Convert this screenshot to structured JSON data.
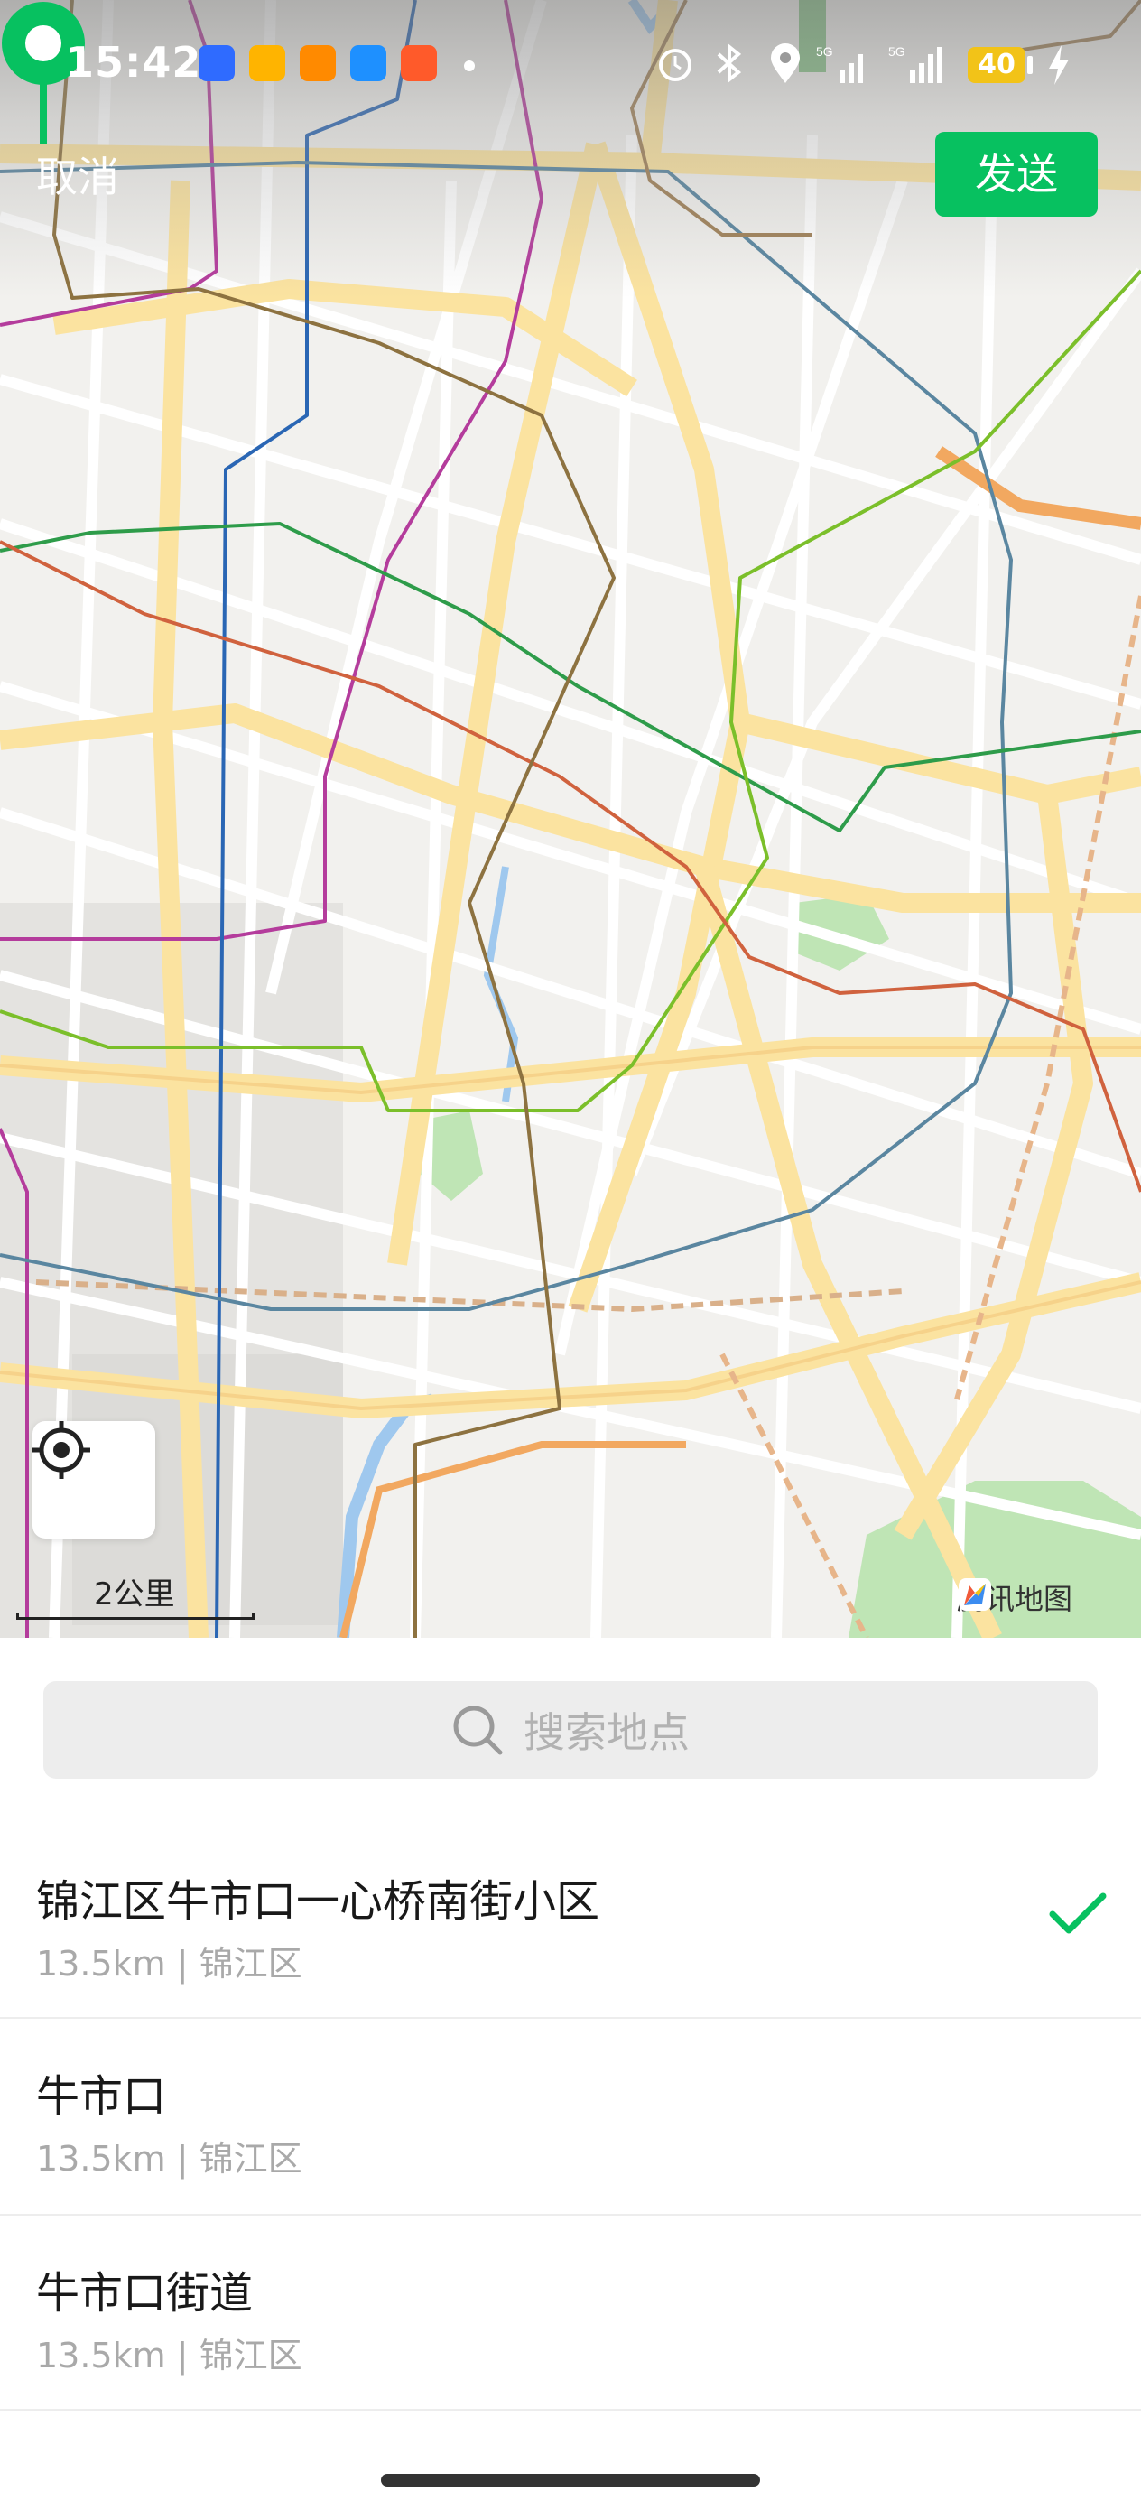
{
  "status_bar": {
    "time": "15:42",
    "battery": "40",
    "icons": [
      "baidu-app-icon",
      "yellow-app-icon",
      "orange-app-icon",
      "blue-app-icon",
      "red-app-icon",
      "alarm-icon",
      "bluetooth-icon",
      "location-icon",
      "signal-5g-icon",
      "signal-5g-icon",
      "charging-icon"
    ],
    "app_colors": [
      "#2f6bff",
      "#ffb400",
      "#ff8a00",
      "#1e90ff",
      "#ff5a2a"
    ]
  },
  "header": {
    "cancel_label": "取消",
    "send_label": "发送",
    "send_color": "#07c160"
  },
  "map": {
    "scale_label": "2公里",
    "attribution": "腾讯地图",
    "pin_color": "#07c160"
  },
  "search": {
    "placeholder": "搜索地点"
  },
  "locations": [
    {
      "name": "锦江区牛市口一心桥南街小区",
      "sub": "13.5km | 锦江区",
      "selected": true
    },
    {
      "name": "牛市口",
      "sub": "13.5km | 锦江区",
      "selected": false
    },
    {
      "name": "牛市口街道",
      "sub": "13.5km | 锦江区",
      "selected": false
    }
  ]
}
